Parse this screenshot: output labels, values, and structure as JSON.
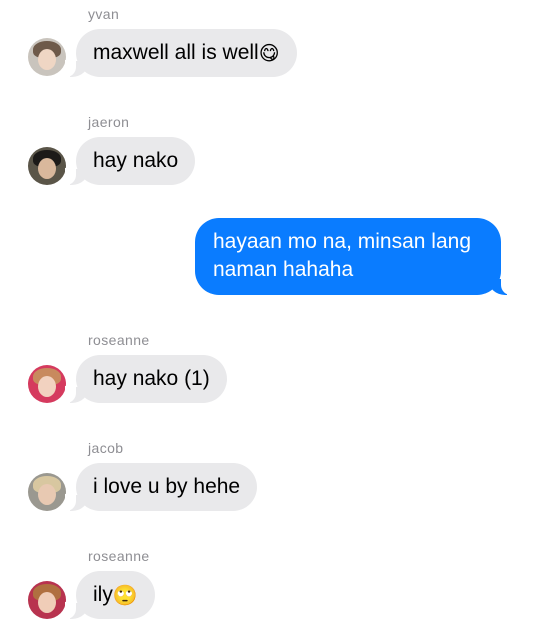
{
  "messages": [
    {
      "sender": "yvan",
      "text": "maxwell all is well",
      "emoji": "😋",
      "avatar_icon": "avatar-yvan"
    },
    {
      "sender": "jaeron",
      "text": "hay nako",
      "avatar_icon": "avatar-jaeron"
    },
    {
      "outgoing_text": "hayaan mo na, minsan lang naman hahaha"
    },
    {
      "sender": "roseanne",
      "text": "hay nako (1)",
      "avatar_icon": "avatar-roseanne"
    },
    {
      "sender": "jacob",
      "text": "i love u by hehe",
      "avatar_icon": "avatar-jacob"
    },
    {
      "sender": "roseanne",
      "text": "ily",
      "emoji": "🙄",
      "avatar_icon": "avatar-roseanne"
    }
  ],
  "colors": {
    "incoming_bubble": "#e9e9eb",
    "outgoing_bubble": "#0a7cff",
    "sender_label": "#8e8e93"
  }
}
